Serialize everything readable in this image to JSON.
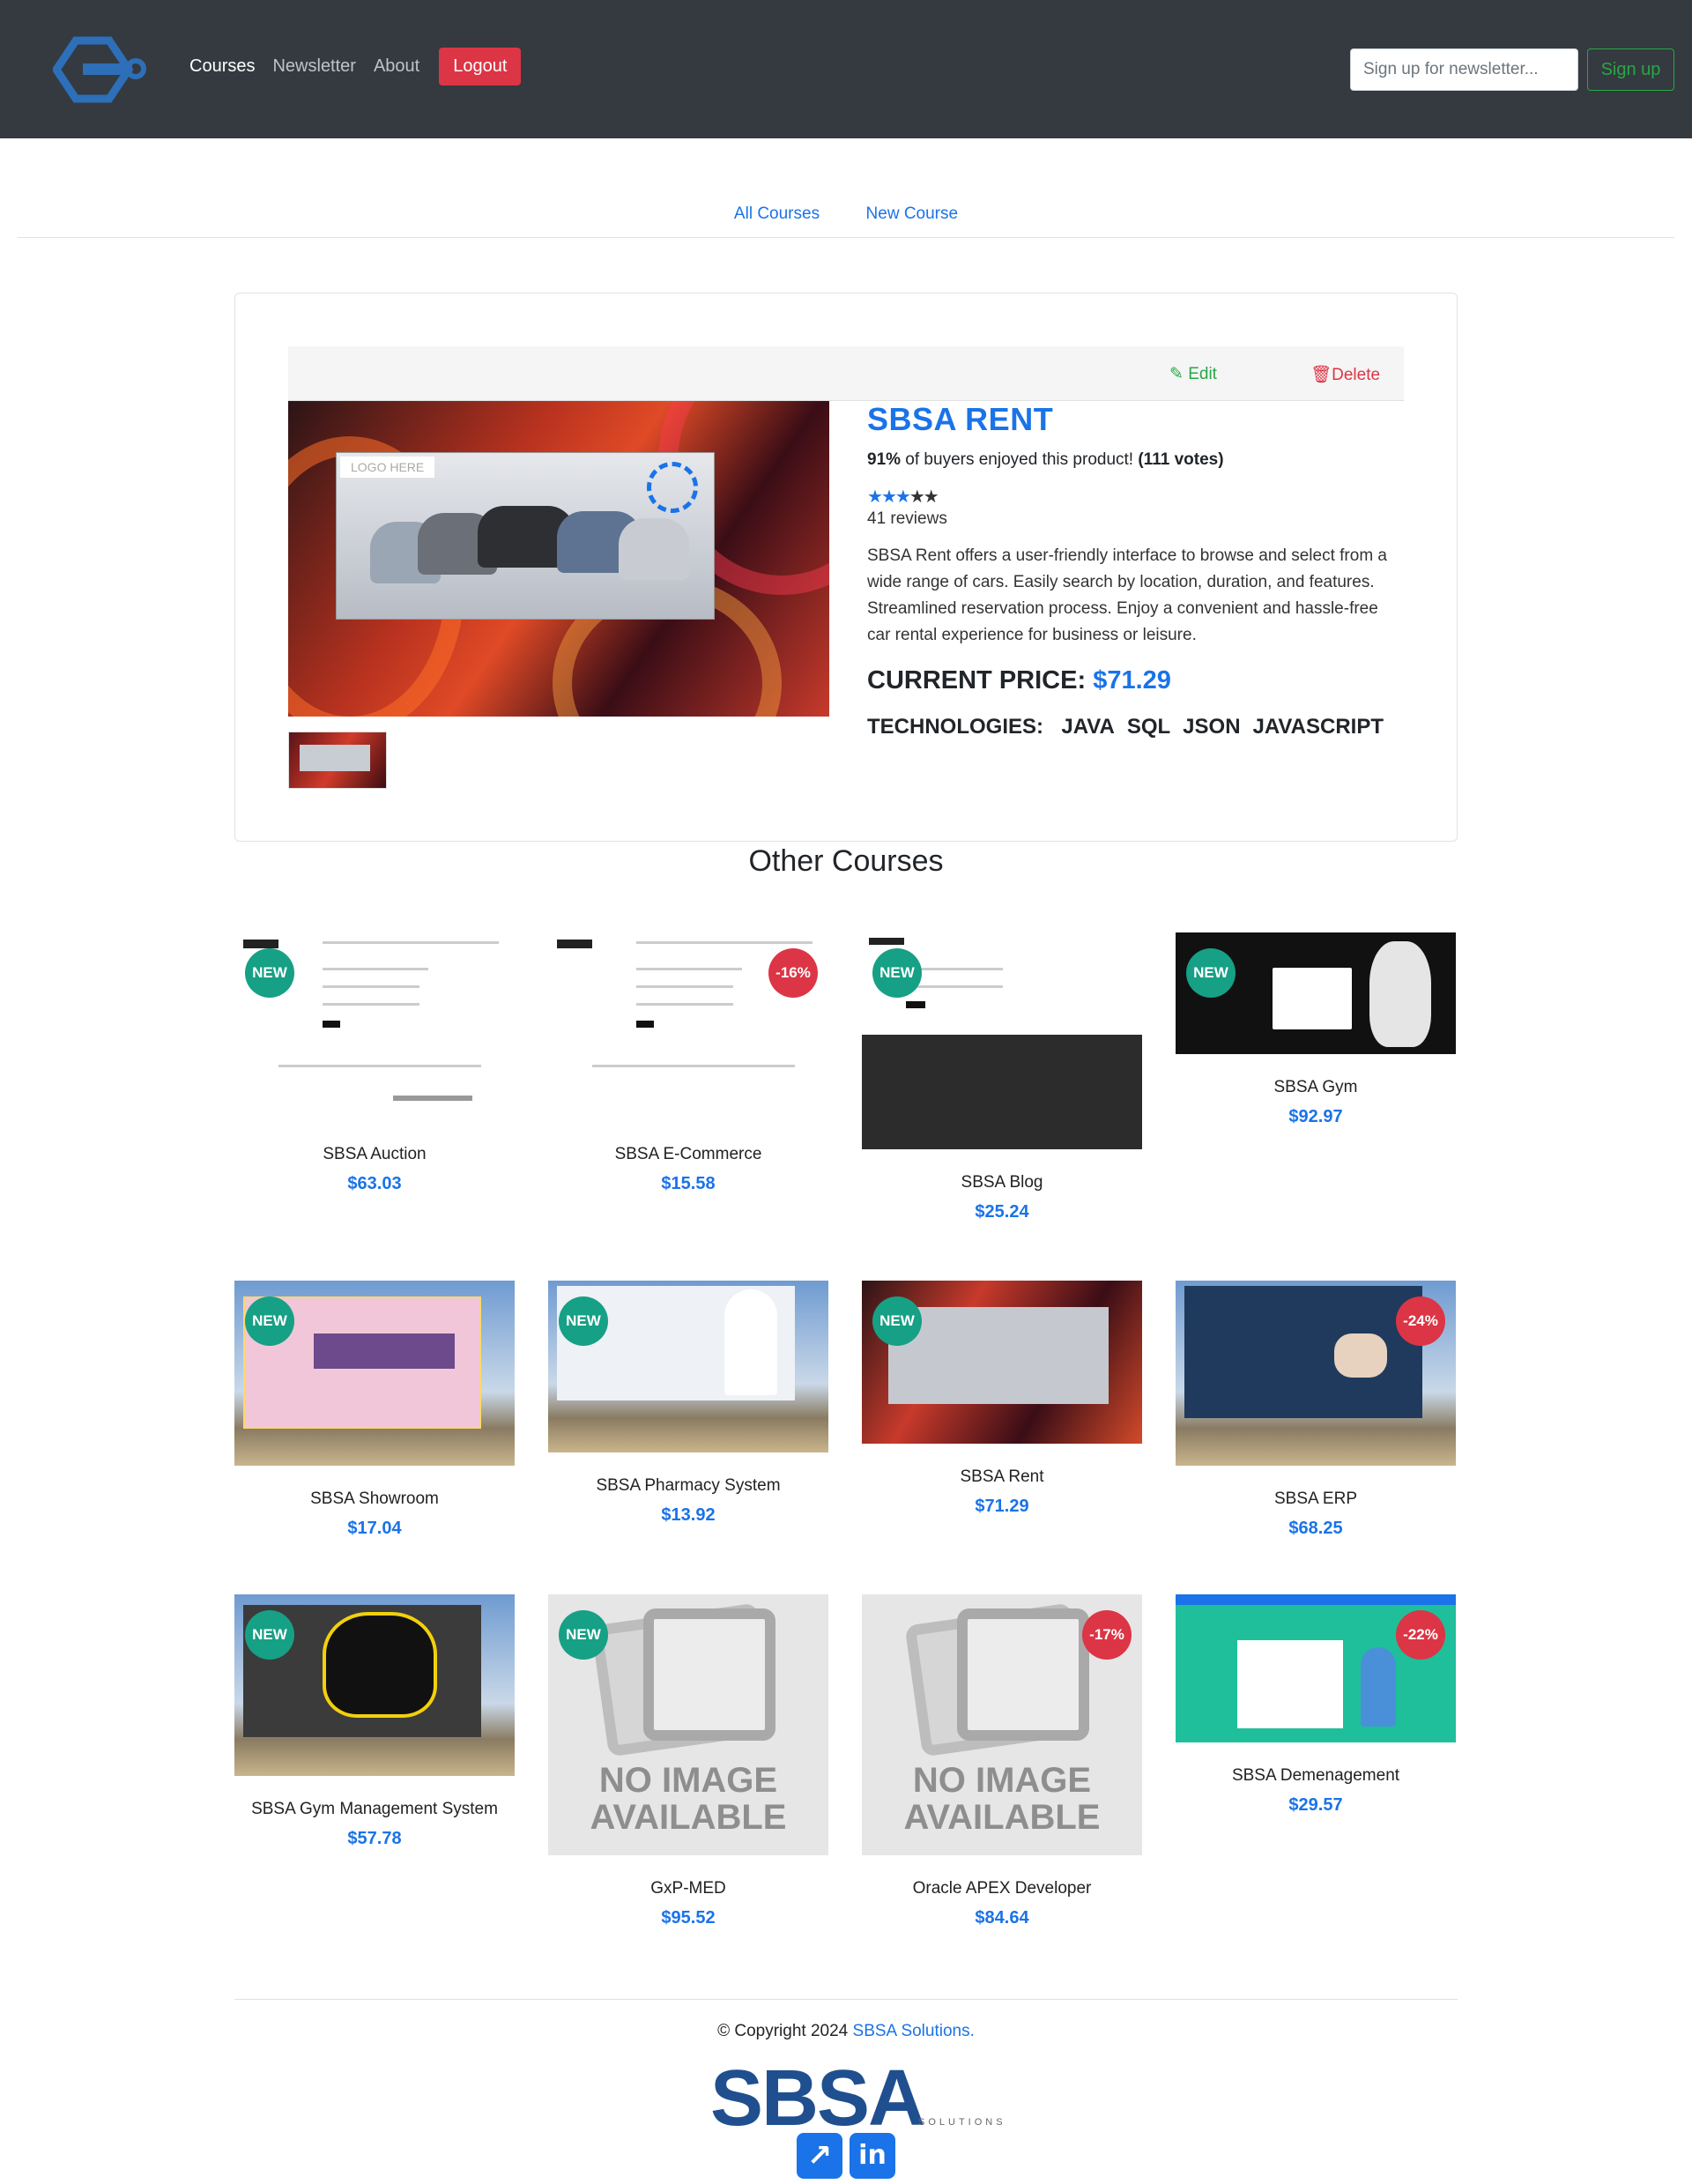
{
  "nav": {
    "links": [
      "Courses",
      "Newsletter",
      "About"
    ],
    "logout": "Logout",
    "newsletter_placeholder": "Sign up for newsletter...",
    "signup": "Sign up"
  },
  "subnav": {
    "all": "All Courses",
    "new": "New Course"
  },
  "toolbar": {
    "edit": "Edit",
    "delete": "Delete"
  },
  "hero": {
    "logo_text": "LOGO HERE"
  },
  "course": {
    "title": "SBSA RENT",
    "rating_percent": "91%",
    "rating_mid": " of buyers enjoyed this product! ",
    "votes": "(111 votes)",
    "stars": 3,
    "max_stars": 5,
    "reviews": "41 reviews",
    "description": "SBSA Rent offers a user-friendly interface to browse and select from a wide range of cars. Easily search by location, duration, and features. Streamlined reservation process. Enjoy a convenient and hassle-free car rental experience for business or leisure.",
    "price_label": "CURRENT PRICE:",
    "price": "$71.29",
    "tech_label": "TECHNOLOGIES:",
    "technologies": [
      "JAVA",
      "SQL",
      "JSON",
      "JAVASCRIPT"
    ]
  },
  "other_title": "Other Courses",
  "other_courses": [
    {
      "name": "SBSA Auction",
      "price": "$63.03",
      "badge": "NEW"
    },
    {
      "name": "SBSA E-Commerce",
      "price": "$15.58",
      "badge": "-16%"
    },
    {
      "name": "SBSA Blog",
      "price": "$25.24",
      "badge": "NEW"
    },
    {
      "name": "SBSA Gym",
      "price": "$92.97",
      "badge": "NEW"
    },
    {
      "name": "SBSA Showroom",
      "price": "$17.04",
      "badge": "NEW"
    },
    {
      "name": "SBSA Pharmacy System",
      "price": "$13.92",
      "badge": "NEW"
    },
    {
      "name": "SBSA Rent",
      "price": "$71.29",
      "badge": "NEW"
    },
    {
      "name": "SBSA ERP",
      "price": "$68.25",
      "badge": "-24%"
    },
    {
      "name": "SBSA Gym Management System",
      "price": "$57.78",
      "badge": "NEW"
    },
    {
      "name": "GxP-MED",
      "price": "$95.52",
      "badge": "NEW"
    },
    {
      "name": "Oracle APEX Developer",
      "price": "$84.64",
      "badge": "-17%"
    },
    {
      "name": "SBSA Demenagement",
      "price": "$29.57",
      "badge": "-22%"
    }
  ],
  "noimg_text": "NO IMAGE AVAILABLE",
  "footer": {
    "copyright": "© Copyright 2024 ",
    "company": "SBSA Solutions.",
    "logo": "SBSA",
    "logo_sub": "SOLUTIONS"
  }
}
